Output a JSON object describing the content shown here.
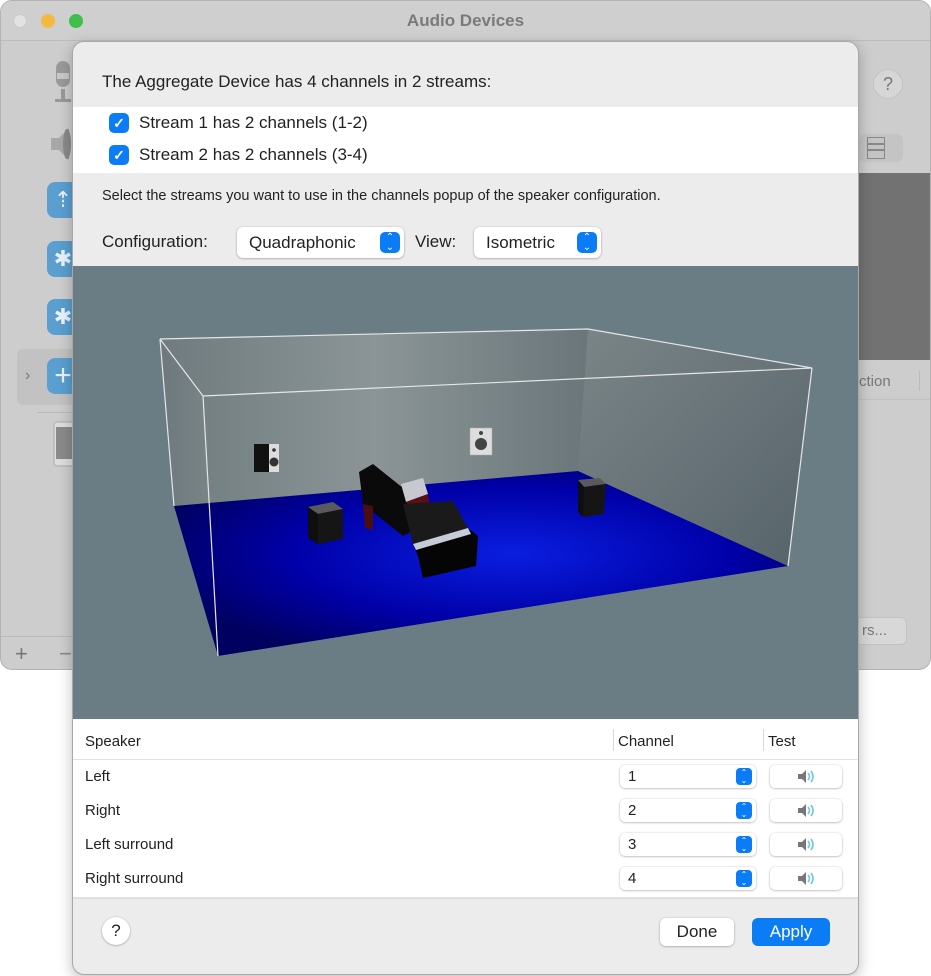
{
  "background_window": {
    "title": "Audio Devices",
    "device_list": [
      {
        "icon": "microphone-icon"
      },
      {
        "icon": "speaker-icon"
      },
      {
        "icon": "usb-icon"
      },
      {
        "icon": "bluetooth-icon"
      },
      {
        "icon": "bluetooth-icon"
      },
      {
        "icon": "aggregate-device-icon",
        "selected": true
      },
      {
        "icon": "iphone-icon"
      }
    ],
    "add_symbol": "+",
    "remove_symbol": "−",
    "help_symbol": "?",
    "column_header_partial": "ction",
    "button_partial": "rs..."
  },
  "sheet": {
    "intro": "The Aggregate Device has 4 channels in 2 streams:",
    "streams": [
      {
        "label": "Stream 1 has 2 channels (1-2)",
        "checked": true
      },
      {
        "label": "Stream 2 has 2 channels (3-4)",
        "checked": true
      }
    ],
    "hint": "Select the streams you want to use in the channels popup of the speaker configuration.",
    "configuration_label": "Configuration:",
    "configuration_value": "Quadraphonic",
    "view_label": "View:",
    "view_value": "Isometric",
    "checkmark": "✓",
    "popup_arrows": "⌃⌄",
    "scene": {
      "description": "Isometric room with quadraphonic speaker layout and sofa",
      "floor_color": "#0000c8",
      "wall_color": "#8a9698",
      "background_color": "#6b7d84"
    },
    "table": {
      "headers": {
        "speaker": "Speaker",
        "channel": "Channel",
        "test": "Test"
      },
      "rows": [
        {
          "speaker": "Left",
          "channel": "1"
        },
        {
          "speaker": "Right",
          "channel": "2"
        },
        {
          "speaker": "Left surround",
          "channel": "3"
        },
        {
          "speaker": "Right surround",
          "channel": "4"
        }
      ]
    },
    "help_symbol": "?",
    "done_label": "Done",
    "apply_label": "Apply",
    "accent_color": "#0a7cf5"
  }
}
